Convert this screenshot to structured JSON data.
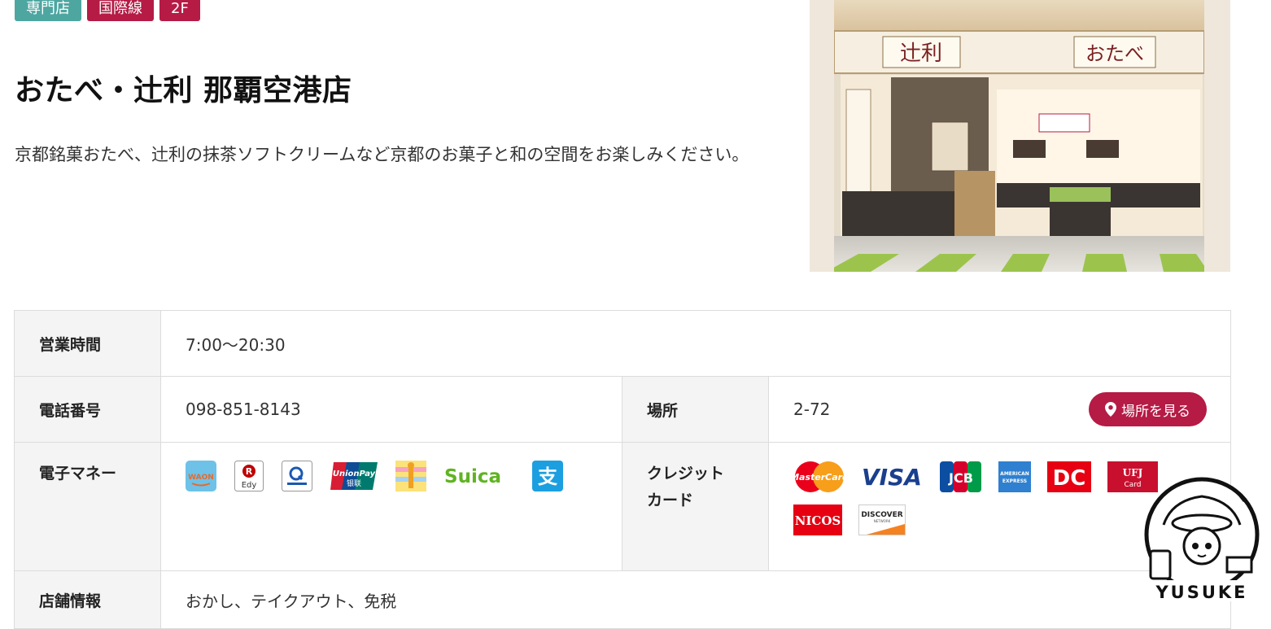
{
  "tags": [
    "専門店",
    "国際線",
    "2F"
  ],
  "title": "おたべ・辻利 那覇空港店",
  "description": "京都銘菓おたべ、辻利の抹茶ソフトクリームなど京都のお菓子と和の空間をお楽しみください。",
  "photo": {
    "signs": [
      "辻利",
      "おたべ"
    ]
  },
  "info": {
    "hours_label": "営業時間",
    "hours": "7:00～20:30",
    "phone_label": "電話番号",
    "phone": "098-851-8143",
    "location_label": "場所",
    "location": "2-72",
    "map_button": "場所を見る",
    "emoney_label": "電子マネー",
    "emoney_icons": [
      "waon-icon",
      "rakuten-edy-icon",
      "quicpay-icon",
      "unionpay-icon",
      "nanaco-icon",
      "suica-icon",
      "alipay-icon"
    ],
    "emoney_text": {
      "waon": "WAON",
      "edy": "Edy",
      "unionpay": "UnionPay",
      "unionpay_cn": "银联",
      "suica": "Suica",
      "alipay": "支"
    },
    "credit_label": "クレジットカード",
    "credit_label_lines": [
      "クレジット",
      "カード"
    ],
    "credit_icons": [
      "mastercard-icon",
      "visa-icon",
      "jcb-icon",
      "amex-icon",
      "dc-card-icon",
      "ufj-card-icon",
      "nicos-icon",
      "discover-icon"
    ],
    "credit_text": {
      "mastercard": "MasterCard",
      "visa": "VISA",
      "jcb": "JCB",
      "amex": "AMERICAN EXPRESS",
      "dc": "DC",
      "ufj": "UFJ",
      "ufj_sub": "Card",
      "nicos": "NICOS",
      "discover": "DISCOVER",
      "discover_sub": "NETWORK"
    },
    "store_label": "店舗情報",
    "store_info": "おかし、テイクアウト、免税"
  },
  "stamp_text": "YUSUKE",
  "colors": {
    "accent": "#b51b45",
    "teal": "#4ea6a1",
    "header_bg": "#f4f4f4"
  }
}
